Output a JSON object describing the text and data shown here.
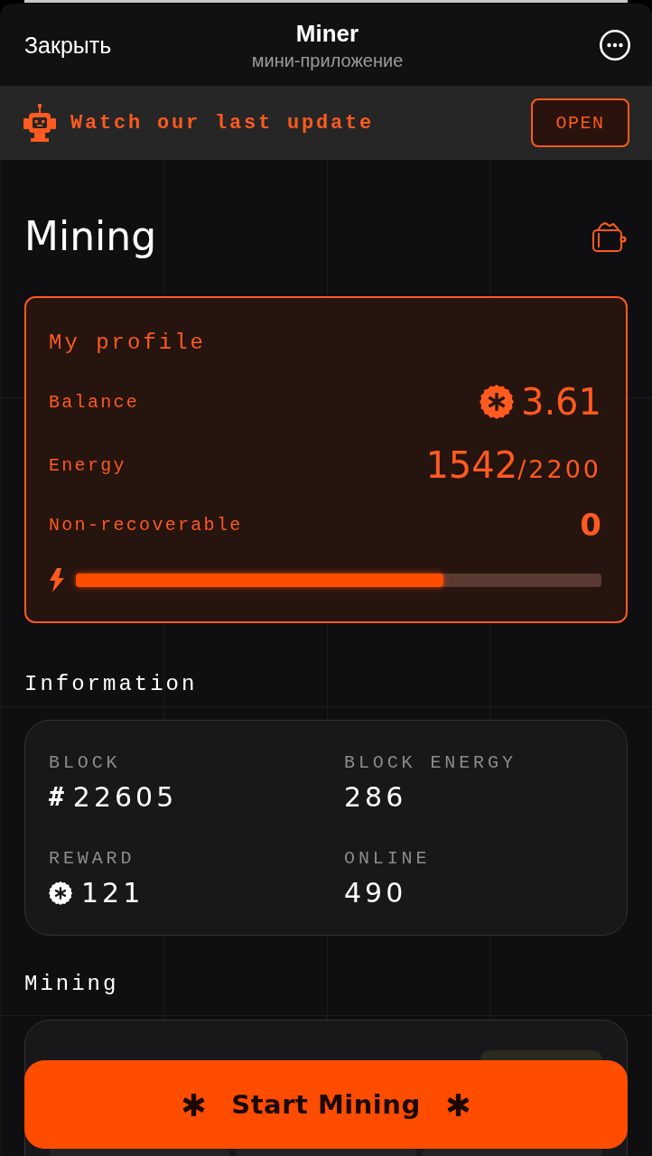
{
  "header": {
    "close_label": "Закрыть",
    "title": "Miner",
    "subtitle": "мини-приложение"
  },
  "banner": {
    "text": "Watch our last update",
    "button_label": "OPEN"
  },
  "page_title": "Mining",
  "profile": {
    "title": "My profile",
    "balance": {
      "label": "Balance",
      "value": "3.61"
    },
    "energy": {
      "label": "Energy",
      "value": "1542",
      "max": "/2200"
    },
    "non_recoverable": {
      "label": "Non-recoverable",
      "value": "0"
    },
    "energy_bar": {
      "level": 0.7
    }
  },
  "information": {
    "title": "Information",
    "stats": [
      {
        "kind": "prefixed",
        "label": "BLOCK",
        "prefix": "#",
        "value": "22605"
      },
      {
        "kind": "plain",
        "label": "BLOCK ENERGY",
        "value": "286"
      },
      {
        "kind": "coin",
        "label": "REWARD",
        "value": "121"
      },
      {
        "kind": "plain",
        "label": "ONLINE",
        "value": "490"
      }
    ]
  },
  "mining": {
    "title": "Mining"
  },
  "start_button": {
    "label": "Start Mining"
  }
}
